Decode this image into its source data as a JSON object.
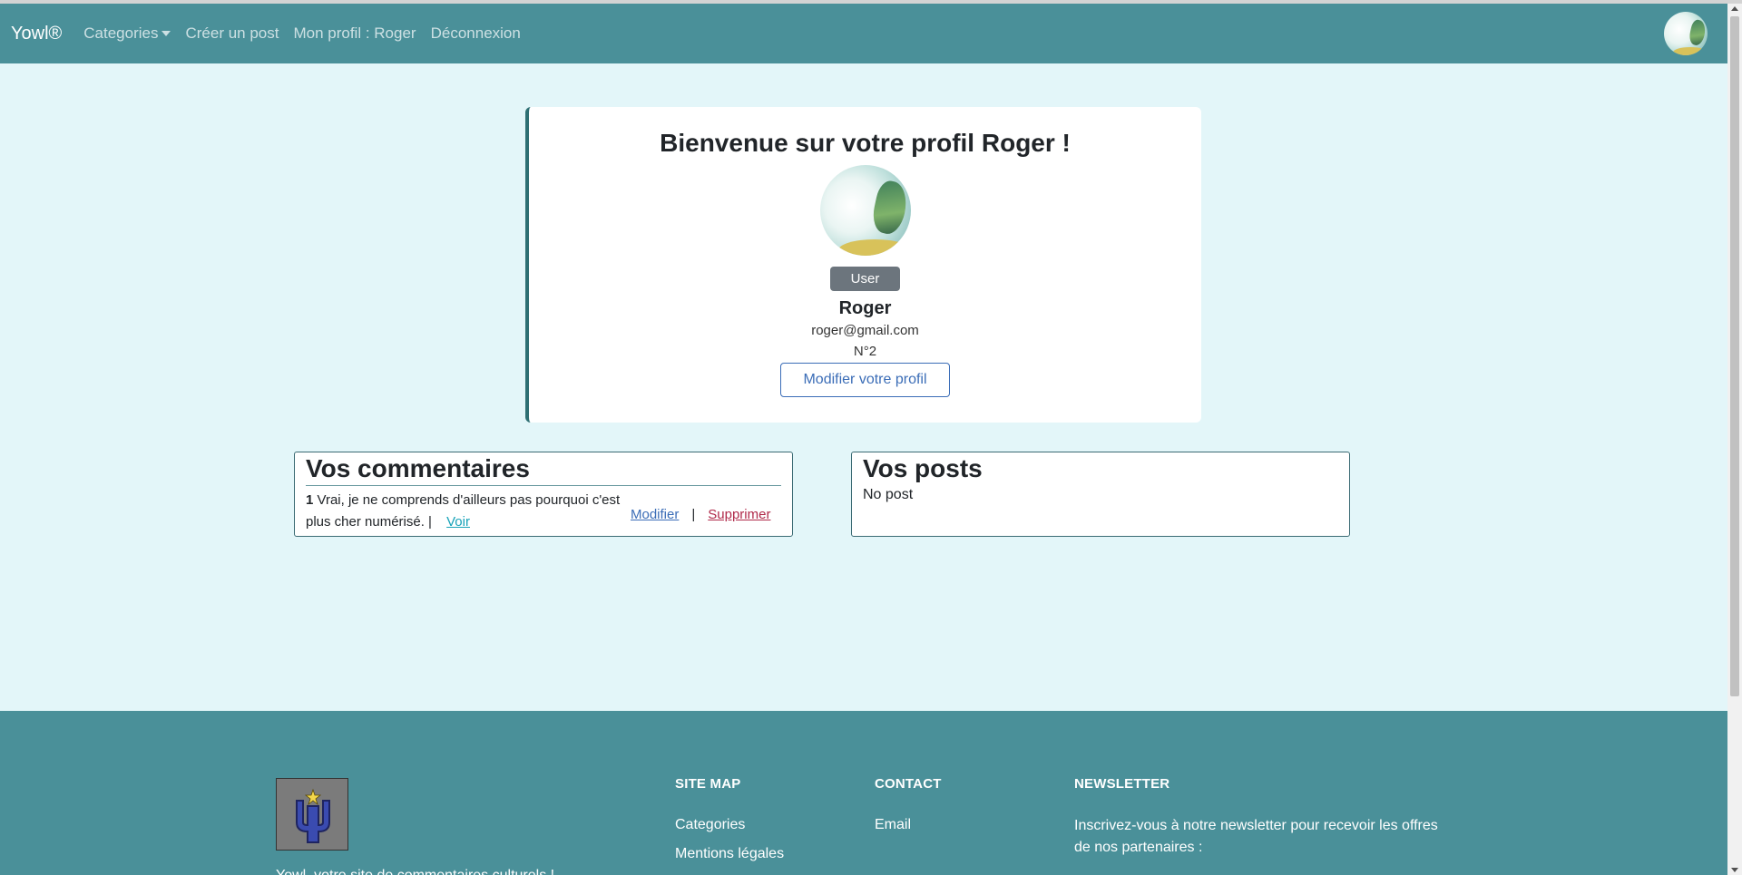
{
  "navbar": {
    "brand": "Yowl®",
    "categories": "Categories",
    "create_post": "Créer un post",
    "profile": "Mon profil : Roger",
    "logout": "Déconnexion",
    "bg_color": "#4a9099"
  },
  "profile": {
    "title": "Bienvenue sur votre profil Roger !",
    "role_badge": "User",
    "name": "Roger",
    "email": "roger@gmail.com",
    "id": "N°2",
    "edit_button": "Modifier votre profil"
  },
  "comments": {
    "title": "Vos commentaires",
    "items": [
      {
        "number": "1",
        "text": " Vrai, je ne comprends d'ailleurs pas pourquoi c'est plus cher numérisé. | ",
        "view": "Voir",
        "edit": "Modifier",
        "separator": "|",
        "delete": "Supprimer"
      }
    ]
  },
  "posts": {
    "title": "Vos posts",
    "empty": "No post"
  },
  "footer": {
    "tagline": "Yowl, votre site de commentaires culturels !",
    "sitemap": {
      "title": "SITE MAP",
      "links": [
        "Categories",
        "Mentions légales"
      ]
    },
    "contact": {
      "title": "CONTACT",
      "links": [
        "Email"
      ]
    },
    "newsletter": {
      "title": "NEWSLETTER",
      "text": "Inscrivez-vous à notre newsletter pour recevoir les offres de nos partenaires :"
    }
  }
}
